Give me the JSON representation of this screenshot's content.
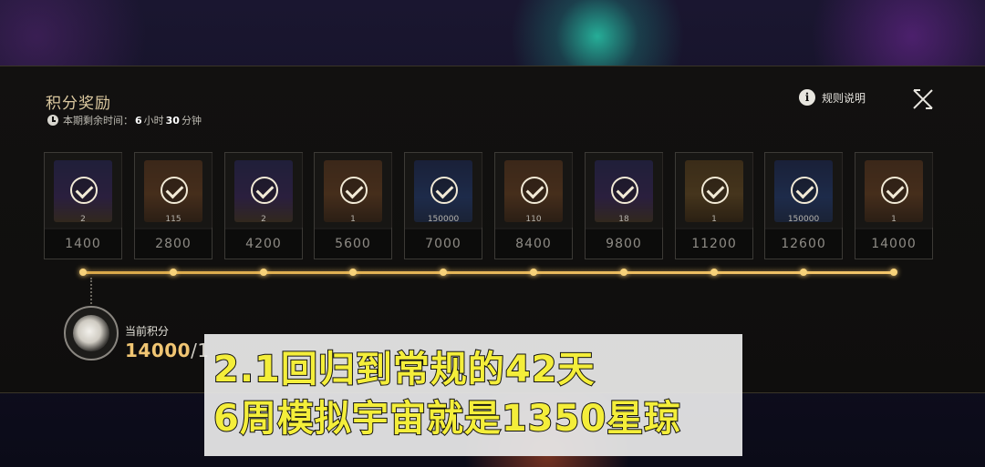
{
  "panel": {
    "title": "积分奖励",
    "timer_prefix": "本期剩余时间：",
    "timer_hours": "6",
    "timer_hours_unit": "小时",
    "timer_minutes": "30",
    "timer_minutes_unit": "分钟",
    "rules_label": "规则说明"
  },
  "rewards": [
    {
      "qty": "2",
      "points": "1400",
      "tone": "purple",
      "claimed": true
    },
    {
      "qty": "115",
      "points": "2800",
      "tone": "orange",
      "claimed": true
    },
    {
      "qty": "2",
      "points": "4200",
      "tone": "purple",
      "claimed": true
    },
    {
      "qty": "1",
      "points": "5600",
      "tone": "orange",
      "claimed": true
    },
    {
      "qty": "150000",
      "points": "7000",
      "tone": "blue",
      "claimed": true
    },
    {
      "qty": "110",
      "points": "8400",
      "tone": "orange",
      "claimed": true
    },
    {
      "qty": "18",
      "points": "9800",
      "tone": "purple",
      "claimed": true
    },
    {
      "qty": "1",
      "points": "11200",
      "tone": "gold",
      "claimed": true
    },
    {
      "qty": "150000",
      "points": "12600",
      "tone": "blue",
      "claimed": true
    },
    {
      "qty": "1",
      "points": "14000",
      "tone": "orange",
      "claimed": true
    }
  ],
  "current": {
    "label": "当前积分",
    "value": "14000",
    "separator": "/",
    "max_partial": "1"
  },
  "caption": {
    "line1": "2.1回归到常规的42天",
    "line2": "6周模拟宇宙就是1350星琼"
  },
  "colors": {
    "accent_gold": "#f0c573",
    "title_gold": "#dcc9a0",
    "caption_text": "#f4ee3a"
  },
  "icons": {
    "timer": "clock-icon",
    "rules": "info-icon",
    "close": "close-icon",
    "claimed": "check-icon"
  }
}
